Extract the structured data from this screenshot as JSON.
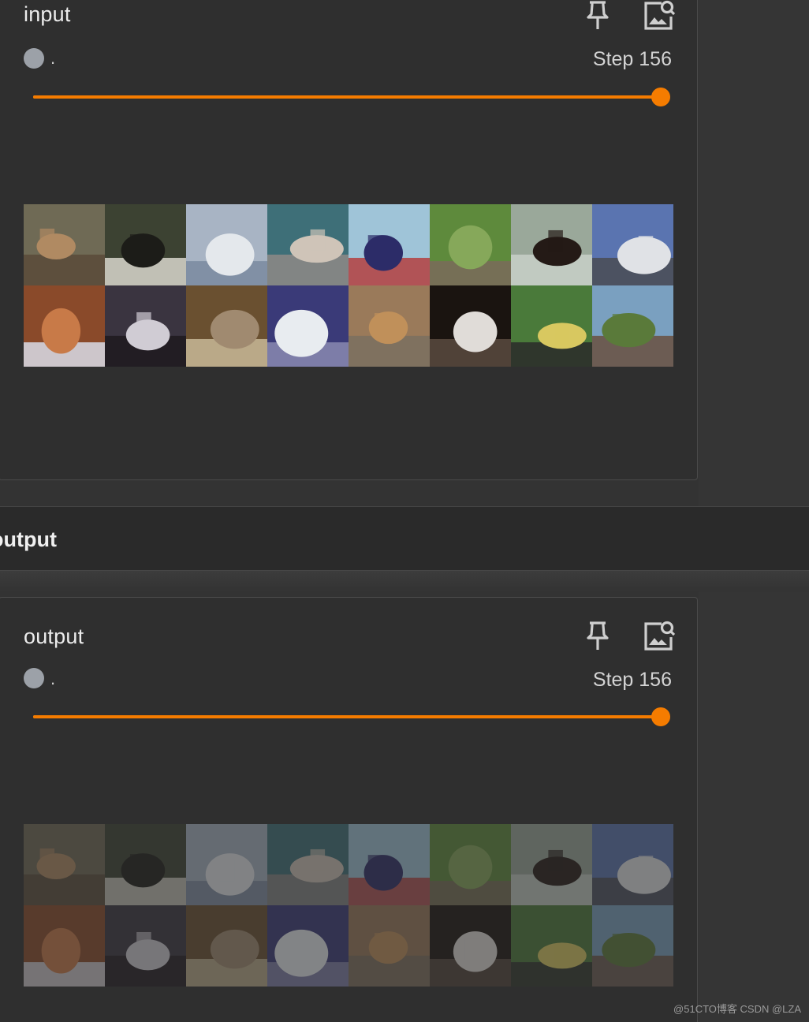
{
  "colors": {
    "accent": "#f57c00",
    "run_dot": "#9ca1a8",
    "background": "#2f2f2f"
  },
  "icons": {
    "pin": "pin-icon",
    "image_search": "image-search-icon"
  },
  "cards": {
    "input": {
      "title": "input",
      "run_name": ".",
      "step_label": "Step 156",
      "step_value": 156,
      "slider_fraction": 1.0
    },
    "output": {
      "title": "output",
      "run_name": ".",
      "step_label": "Step 156",
      "step_value": 156,
      "slider_fraction": 1.0
    }
  },
  "section": {
    "title": "output"
  },
  "thumbnails": [
    {
      "subject": "horse-rider",
      "colors": [
        "#6f6a55",
        "#b08a62",
        "#5b4a3a"
      ]
    },
    {
      "subject": "dog",
      "colors": [
        "#3c4232",
        "#1c1c18",
        "#d8d6cc"
      ]
    },
    {
      "subject": "boat",
      "colors": [
        "#a8b4c4",
        "#e4e8ec",
        "#7a8aa0"
      ]
    },
    {
      "subject": "airplane",
      "colors": [
        "#3e6f78",
        "#cfc4b8",
        "#8e8a86"
      ]
    },
    {
      "subject": "ship",
      "colors": [
        "#9fc4d8",
        "#2c2c68",
        "#b44040"
      ]
    },
    {
      "subject": "deer",
      "colors": [
        "#5e8a3c",
        "#86a85a",
        "#7a6a5a"
      ]
    },
    {
      "subject": "horse",
      "colors": [
        "#9aa89a",
        "#241a16",
        "#c8d0c8"
      ]
    },
    {
      "subject": "airplane",
      "colors": [
        "#5a74b0",
        "#e0e2e6",
        "#4a4c54"
      ]
    },
    {
      "subject": "cat",
      "colors": [
        "#8a4a2a",
        "#c87a48",
        "#d8dce8"
      ]
    },
    {
      "subject": "dog",
      "colors": [
        "#3a3440",
        "#d0ccd4",
        "#1e1a1e"
      ]
    },
    {
      "subject": "cat",
      "colors": [
        "#6a5030",
        "#a08a70",
        "#c8b898"
      ]
    },
    {
      "subject": "boat",
      "colors": [
        "#3a3a78",
        "#e8ecf0",
        "#8a8ab0"
      ]
    },
    {
      "subject": "dog",
      "colors": [
        "#9a7a5a",
        "#c0905a",
        "#7a7060"
      ]
    },
    {
      "subject": "dog",
      "colors": [
        "#1a1410",
        "#e0dcd8",
        "#5a4a40"
      ]
    },
    {
      "subject": "car",
      "colors": [
        "#4a7a3a",
        "#d8c860",
        "#2a2a2a"
      ]
    },
    {
      "subject": "horse",
      "colors": [
        "#7aa0c0",
        "#5a7a3a",
        "#6a5040"
      ]
    }
  ],
  "watermark": "@51CTO博客 CSDN @LZA"
}
